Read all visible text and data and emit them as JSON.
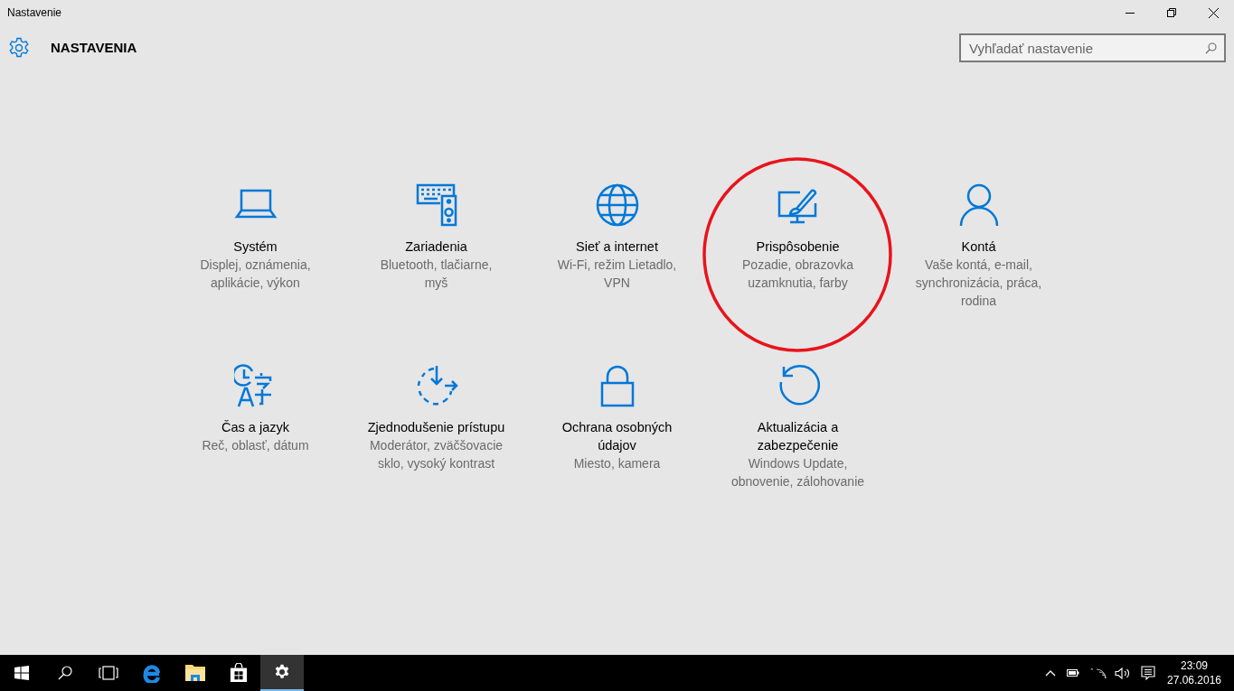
{
  "window": {
    "title": "Nastavenie"
  },
  "header": {
    "title": "NASTAVENIA"
  },
  "search": {
    "placeholder": "Vyhľadať nastavenie"
  },
  "categories": [
    {
      "kind": "laptop",
      "title": "Systém",
      "description": "Displej, oznámenia, aplikácie, výkon"
    },
    {
      "kind": "devices",
      "title": "Zariadenia",
      "description": "Bluetooth, tlačiarne, myš"
    },
    {
      "kind": "globe",
      "title": "Sieť a internet",
      "description": "Wi-Fi, režim Lietadlo, VPN"
    },
    {
      "kind": "personalize",
      "title": "Prispôsobenie",
      "description": "Pozadie, obrazovka uzamknutia, farby"
    },
    {
      "kind": "person",
      "title": "Kontá",
      "description": "Vaše kontá, e-mail, synchronizácia, práca, rodina"
    },
    {
      "kind": "language",
      "title": "Čas a jazyk",
      "description": "Reč, oblasť, dátum"
    },
    {
      "kind": "access",
      "title": "Zjednodušenie prístupu",
      "description": "Moderátor, zväčšovacie sklo, vysoký kontrast"
    },
    {
      "kind": "lock",
      "title": "Ochrana osobných údajov",
      "description": "Miesto, kamera"
    },
    {
      "kind": "update",
      "title": "Aktualizácia a zabezpečenie",
      "description": "Windows Update, obnovenie, zálohovanie"
    }
  ],
  "taskbar": {
    "items": [
      {
        "kind": "start",
        "selected": false
      },
      {
        "kind": "search",
        "selected": false
      },
      {
        "kind": "taskview",
        "selected": false
      },
      {
        "kind": "edge",
        "selected": false
      },
      {
        "kind": "explorer",
        "selected": false
      },
      {
        "kind": "store",
        "selected": false
      },
      {
        "kind": "settings",
        "selected": true
      }
    ],
    "time": "23:09",
    "date": "27.06.2016"
  }
}
